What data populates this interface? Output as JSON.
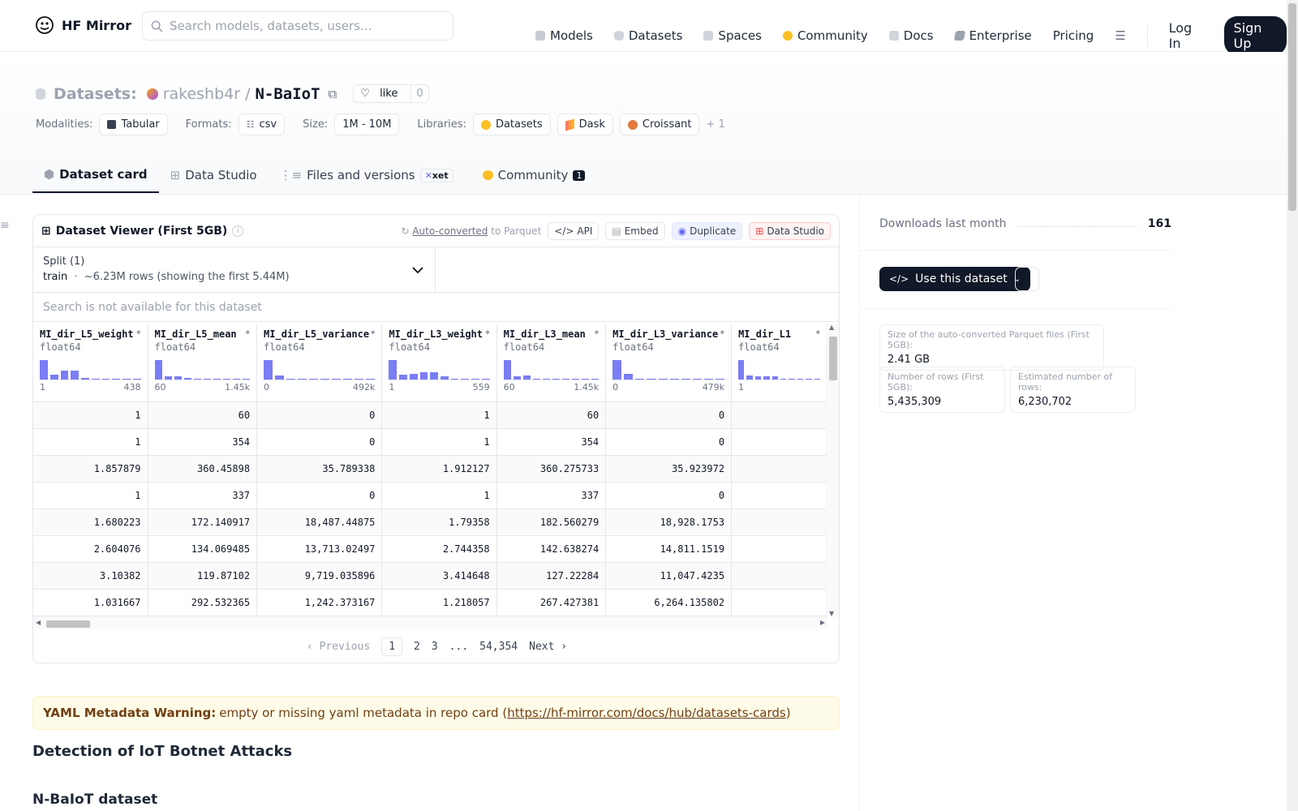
{
  "nav": {
    "brand": "HF Mirror",
    "search_placeholder": "Search models, datasets, users...",
    "links": [
      "Models",
      "Datasets",
      "Spaces",
      "Community",
      "Docs",
      "Enterprise",
      "Pricing"
    ],
    "login": "Log In",
    "signup": "Sign Up"
  },
  "header": {
    "type_label": "Datasets:",
    "owner": "rakeshb4r",
    "sep": "/",
    "repo": "N-BaIoT",
    "like_label": "like",
    "like_count": "0",
    "modalities_label": "Modalities:",
    "modality": "Tabular",
    "formats_label": "Formats:",
    "format": "csv",
    "size_label": "Size:",
    "size": "1M - 10M",
    "libraries_label": "Libraries:",
    "libraries": [
      "Datasets",
      "Dask",
      "Croissant"
    ],
    "more_libraries": "+ 1"
  },
  "tabs": {
    "card": "Dataset card",
    "studio": "Data Studio",
    "files": "Files and versions",
    "xet": "xet",
    "community": "Community",
    "community_count": "1"
  },
  "viewer": {
    "title": "Dataset Viewer (First 5GB)",
    "auto_converted": "Auto-converted",
    "to_parquet": "to Parquet",
    "api": "API",
    "embed": "Embed",
    "duplicate": "Duplicate",
    "data_studio": "Data Studio",
    "split_label": "Split (1)",
    "split_name": "train",
    "split_sep": "·",
    "split_rows": "~6.23M rows (showing the first 5.44M)",
    "search_placeholder": "Search is not available for this dataset",
    "columns": [
      {
        "name": "MI_dir_L5_weight",
        "type": "float64",
        "min": "1",
        "max": "438",
        "hist": [
          0.95,
          0.25,
          0.45,
          0.45,
          0.08,
          0.05,
          0.05,
          0.04,
          0.04,
          0.04
        ]
      },
      {
        "name": "MI_dir_L5_mean",
        "type": "float64",
        "min": "60",
        "max": "1.45k",
        "hist": [
          0.95,
          0.18,
          0.15,
          0.1,
          0.05,
          0.04,
          0.04,
          0.04,
          0.04,
          0.04
        ]
      },
      {
        "name": "MI_dir_L5_variance",
        "type": "float64",
        "min": "0",
        "max": "492k",
        "hist": [
          0.95,
          0.2,
          0.05,
          0.04,
          0.04,
          0.04,
          0.04,
          0.04,
          0.04,
          0.04
        ]
      },
      {
        "name": "MI_dir_L3_weight",
        "type": "float64",
        "min": "1",
        "max": "559",
        "hist": [
          0.95,
          0.25,
          0.3,
          0.38,
          0.38,
          0.15,
          0.05,
          0.04,
          0.04,
          0.04
        ]
      },
      {
        "name": "MI_dir_L3_mean",
        "type": "float64",
        "min": "60",
        "max": "1.45k",
        "hist": [
          0.95,
          0.15,
          0.22,
          0.05,
          0.04,
          0.04,
          0.04,
          0.04,
          0.04,
          0.04
        ]
      },
      {
        "name": "MI_dir_L3_variance",
        "type": "float64",
        "min": "0",
        "max": "479k",
        "hist": [
          0.95,
          0.28,
          0.05,
          0.04,
          0.04,
          0.04,
          0.04,
          0.04,
          0.04,
          0.04
        ]
      },
      {
        "name": "MI_dir_L1",
        "type": "float64",
        "min": "1",
        "max": "",
        "hist": [
          0.95,
          0.2,
          0.18,
          0.15,
          0.15,
          0.05,
          0.04,
          0.04,
          0.04,
          0.04
        ]
      }
    ],
    "rows": [
      [
        "1",
        "60",
        "0",
        "1",
        "60",
        "0",
        ""
      ],
      [
        "1",
        "354",
        "0",
        "1",
        "354",
        "0",
        ""
      ],
      [
        "1.857879",
        "360.45898",
        "35.789338",
        "1.912127",
        "360.275733",
        "35.923972",
        ""
      ],
      [
        "1",
        "337",
        "0",
        "1",
        "337",
        "0",
        ""
      ],
      [
        "1.680223",
        "172.140917",
        "18,487.44875",
        "1.79358",
        "182.560279",
        "18,928.1753",
        ""
      ],
      [
        "2.604076",
        "134.069485",
        "13,713.02497",
        "2.744358",
        "142.638274",
        "14,811.1519",
        ""
      ],
      [
        "3.10382",
        "119.87102",
        "9,719.035896",
        "3.414648",
        "127.22284",
        "11,047.4235",
        ""
      ],
      [
        "1.031667",
        "292.532365",
        "1,242.373167",
        "1.218057",
        "267.427381",
        "6,264.135802",
        ""
      ],
      [
        "",
        "",
        "",
        "",
        "",
        "",
        ""
      ]
    ],
    "pager": {
      "prev": "Previous",
      "p1": "1",
      "p2": "2",
      "p3": "3",
      "ellipsis": "...",
      "last": "54,354",
      "next": "Next"
    }
  },
  "warning": {
    "label": "YAML Metadata Warning:",
    "text": "empty or missing yaml metadata in repo card (",
    "link": "https://hf-mirror.com/docs/hub/datasets-cards",
    "close": ")"
  },
  "content": {
    "h2": "Detection of IoT Botnet Attacks",
    "h3": "N-BaIoT dataset"
  },
  "sidebar": {
    "downloads_label": "Downloads last month",
    "downloads_value": "161",
    "use_button": "Use this dataset",
    "parquet_size_label": "Size of the auto-converted Parquet files (First 5GB):",
    "parquet_size_value": "2.41 GB",
    "rows_label": "Number of rows (First 5GB):",
    "rows_value": "5,435,309",
    "est_rows_label": "Estimated number of rows:",
    "est_rows_value": "6,230,702"
  },
  "colors": {
    "accent": "#111827",
    "hist_bar": "#6366f1",
    "warn_bg": "#fefce8",
    "warn_text": "#713f12"
  }
}
